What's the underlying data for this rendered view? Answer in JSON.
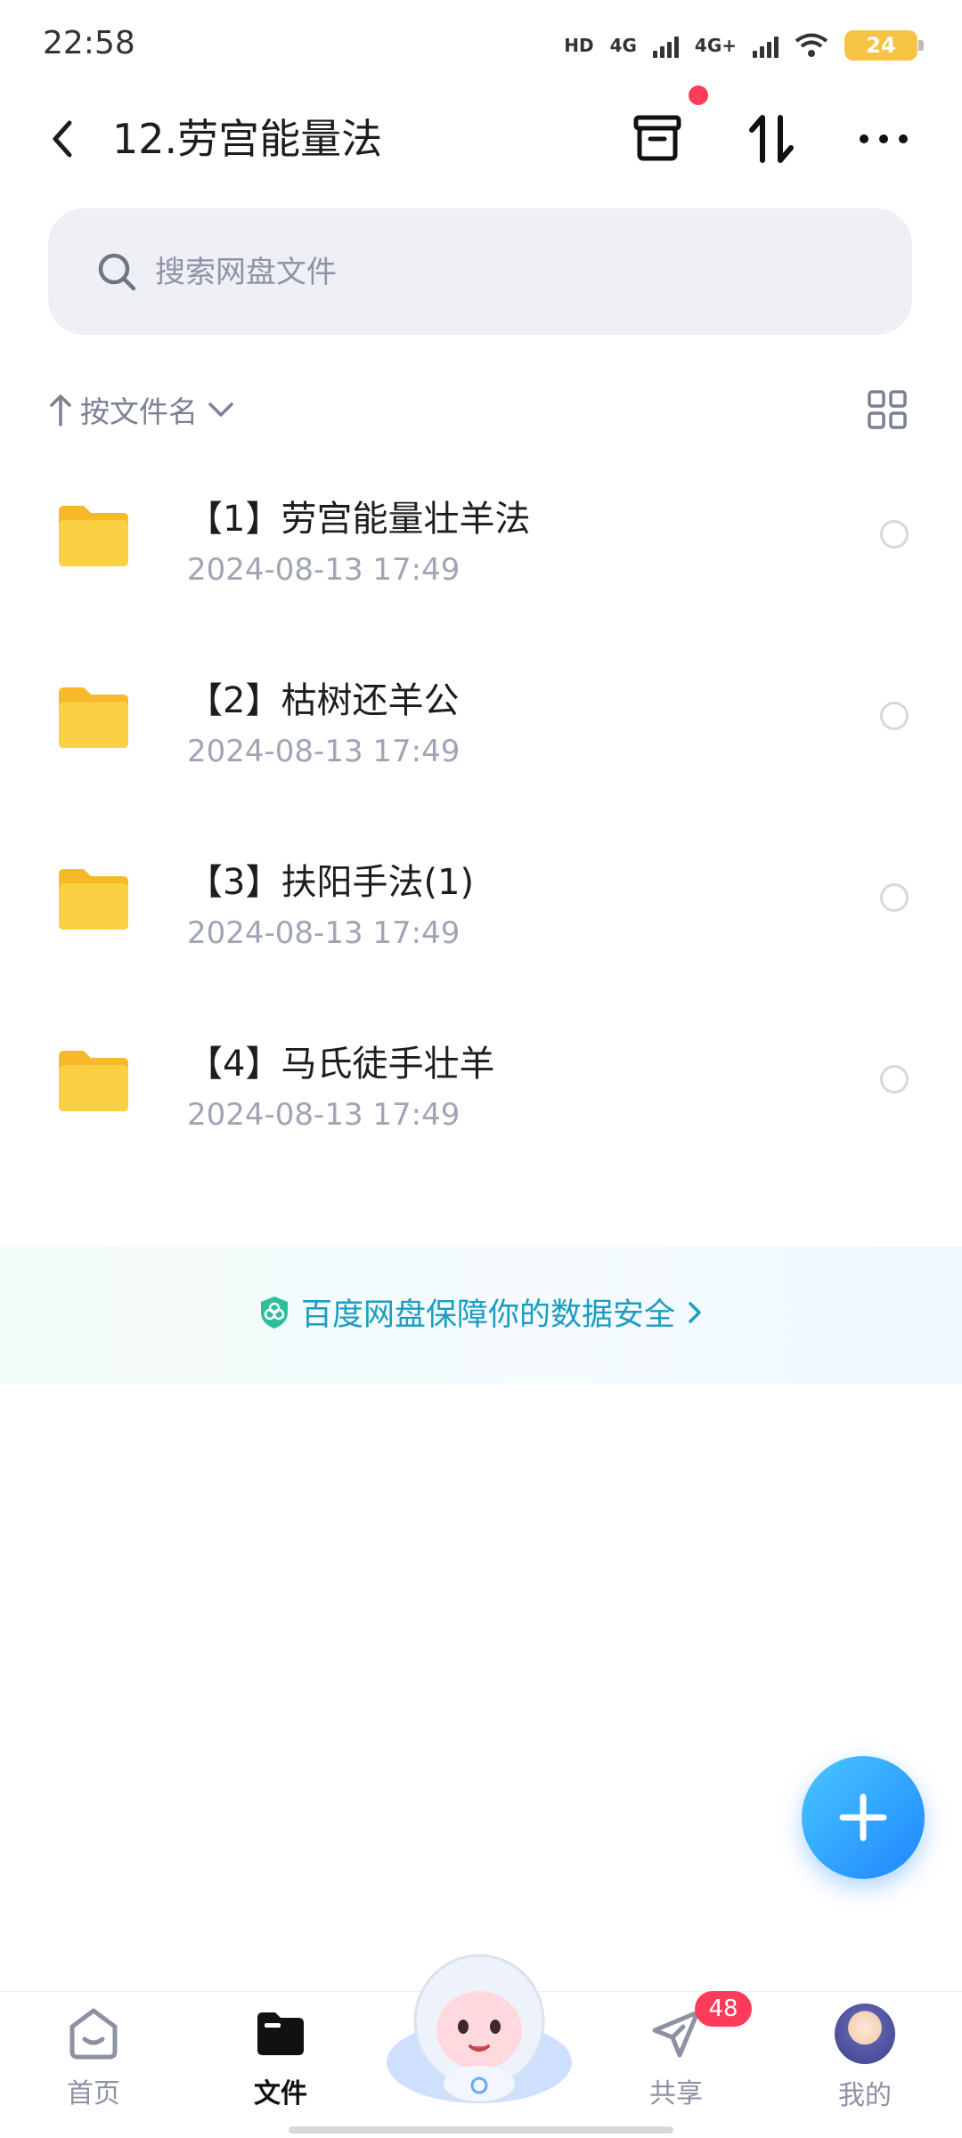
{
  "status_bar": {
    "time": "22:58",
    "hd": "HD",
    "net1": "4G",
    "net2": "4G+",
    "battery": "24"
  },
  "header": {
    "title": "12.劳宫能量法"
  },
  "search": {
    "placeholder": "搜索网盘文件"
  },
  "sort": {
    "label": "按文件名"
  },
  "files": [
    {
      "name": "【1】劳宫能量壮羊法",
      "date": "2024-08-13  17:49"
    },
    {
      "name": "【2】枯树还羊公",
      "date": "2024-08-13  17:49"
    },
    {
      "name": "【3】扶阳手法(1)",
      "date": "2024-08-13  17:49"
    },
    {
      "name": "【4】马氏徒手壮羊",
      "date": "2024-08-13  17:49"
    }
  ],
  "banner": {
    "text": "百度网盘保障你的数据安全"
  },
  "nav": {
    "home": "首页",
    "files": "文件",
    "share": "共享",
    "share_badge": "48",
    "mine": "我的"
  },
  "colors": {
    "accent": "#1e86ff",
    "badge": "#ff3b5c",
    "folder": "#f9c52c",
    "banner_text": "#1a9dc2"
  },
  "icons": [
    "back-icon",
    "recycle-bin-icon",
    "transfer-icon",
    "more-icon",
    "search-icon",
    "sort-arrow-icon",
    "chevron-down-icon",
    "grid-view-icon",
    "folder-icon",
    "shield-icon",
    "chevron-right-icon",
    "plus-icon",
    "home-icon",
    "files-icon",
    "share-icon"
  ]
}
